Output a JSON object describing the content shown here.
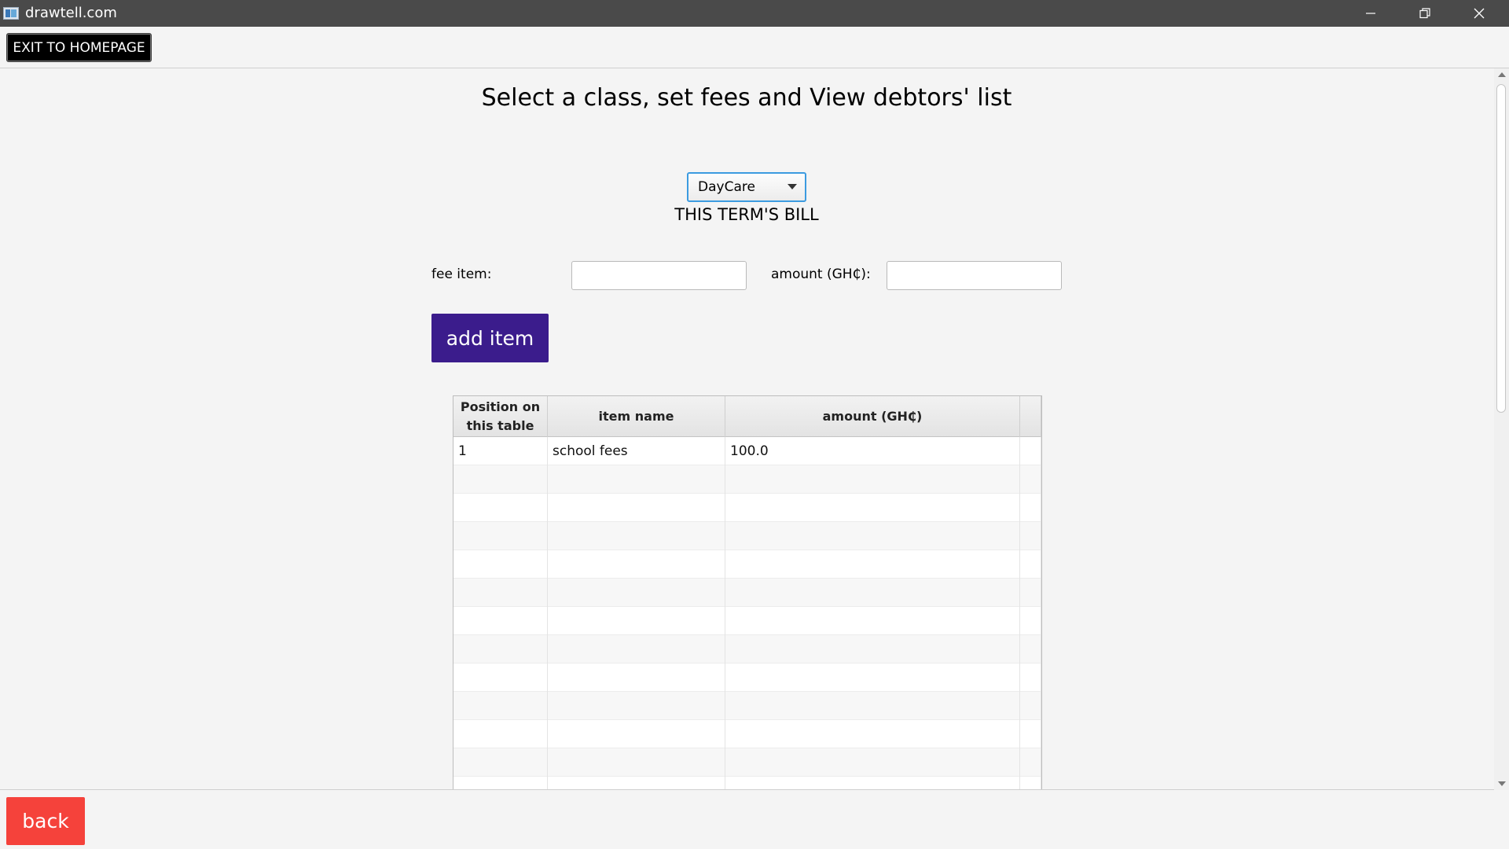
{
  "window": {
    "title": "drawtell.com"
  },
  "toolbar": {
    "exit_label": "EXIT TO HOMEPAGE"
  },
  "page": {
    "heading": "Select a class, set fees and View debtors' list",
    "class_select": {
      "selected": "DayCare"
    },
    "bill_label": "THIS TERM'S BILL"
  },
  "form": {
    "fee_item_label": "fee item:",
    "fee_item_value": "",
    "amount_label": "amount (GH₵):",
    "amount_value": "",
    "add_button_label": "add item"
  },
  "table": {
    "headers": {
      "position": "Position on this table",
      "item_name": "item name",
      "amount": "amount (GH₵)"
    },
    "rows": [
      {
        "position": "1",
        "item_name": "school fees",
        "amount": "100.0"
      }
    ]
  },
  "footer": {
    "back_label": "back"
  },
  "icons": {
    "app": "app-icon",
    "minimize": "minimize-icon",
    "maximize": "restore-icon",
    "close": "close-icon",
    "dropdown": "chevron-down-icon"
  },
  "colors": {
    "titlebar": "#4a4a4a",
    "exit_button": "#000000",
    "add_button": "#3b1c8c",
    "back_button": "#f5423b",
    "focus_border": "#3c9be0"
  }
}
